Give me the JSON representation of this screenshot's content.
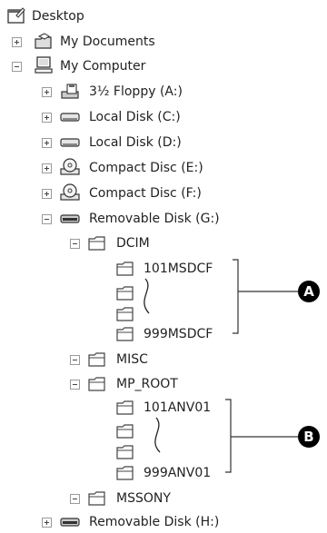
{
  "tree": {
    "desktop": "Desktop",
    "my_documents": "My Documents",
    "my_computer": "My Computer",
    "floppy": "3½ Floppy (A:)",
    "local_c": "Local Disk (C:)",
    "local_d": "Local Disk (D:)",
    "cd_e": "Compact Disc (E:)",
    "cd_f": "Compact Disc (F:)",
    "removable_g": "Removable Disk (G:)",
    "dcim": "DCIM",
    "dcim_first": "101MSDCF",
    "dcim_last": "999MSDCF",
    "misc": "MISC",
    "mp_root": "MP_ROOT",
    "mp_first": "101ANV01",
    "mp_last": "999ANV01",
    "mssony": "MSSONY",
    "removable_h": "Removable Disk (H:)"
  },
  "callouts": {
    "a": "A",
    "b": "B"
  },
  "icons": {
    "desktop": "desktop-icon",
    "documents": "documents-folder-icon",
    "computer": "computer-icon",
    "floppy": "floppy-drive-icon",
    "disk": "hard-disk-icon",
    "cd": "cd-drive-icon",
    "removable": "removable-disk-icon",
    "folder": "folder-icon"
  }
}
